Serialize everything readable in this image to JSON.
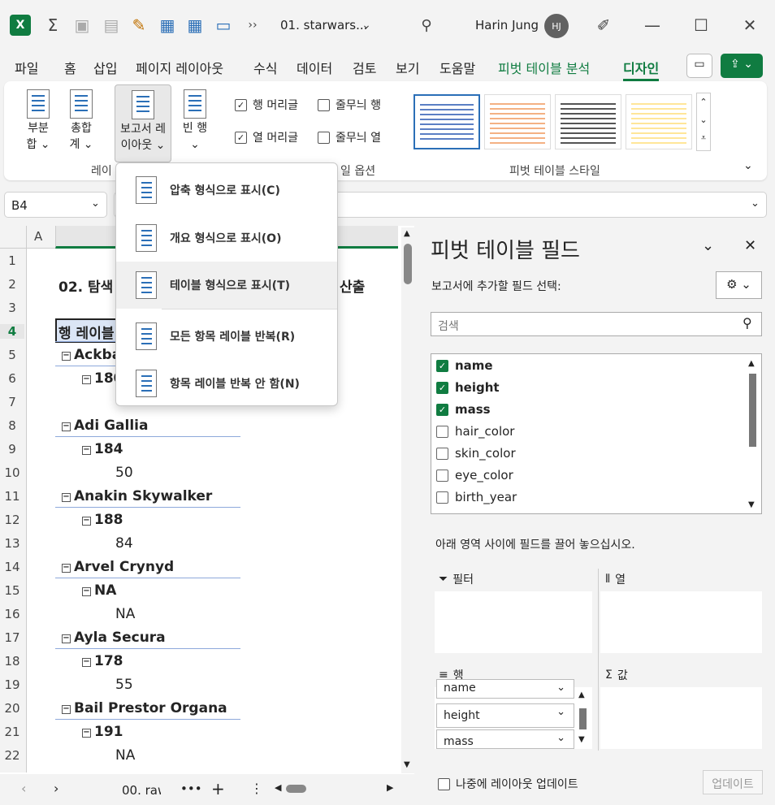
{
  "titlebar": {
    "doc_title": "01. starwars...",
    "user_name": "Harin Jung",
    "avatar_initials": "HJ",
    "overflow": "››"
  },
  "tabs": [
    "파일",
    "홈",
    "삽입",
    "페이지 레이아웃",
    "수식",
    "데이터",
    "검토",
    "보기",
    "도움말",
    "피벗 테이블 분석",
    "디자인"
  ],
  "ribbon": {
    "subtotal": "부분\n합 ⌄",
    "grandtotal": "총합\n계 ⌄",
    "report_layout": "보고서 레\n이아웃 ⌄",
    "blank_rows": "빈 행\n⌄",
    "chk_row_headers": "행 머리글",
    "chk_banded_rows": "줄무늬 행",
    "chk_col_headers": "열 머리글",
    "chk_banded_cols": "줄무늬 열",
    "group_layout": "레이",
    "group_options": "일 옵션",
    "group_styles": "피벗 테이블 스타일"
  },
  "namebox": "B4",
  "dropdown": [
    "압축 형식으로 표시(C)",
    "개요 형식으로 표시(O)",
    "테이블 형식으로 표시(T)",
    "모든 항목 레이블 반복(R)",
    "항목 레이블 반복 안 함(N)"
  ],
  "sheet": {
    "col_a": "A",
    "rows": [
      "1",
      "2",
      "3",
      "4",
      "5",
      "6",
      "7",
      "8",
      "9",
      "10",
      "11",
      "12",
      "13",
      "14",
      "15",
      "16",
      "17",
      "18",
      "19",
      "20",
      "21",
      "22"
    ],
    "title_left": "02. 탐색",
    "title_right": "산출",
    "row_label_header": "행 레이블",
    "c5": "Ackba",
    "c6": "180",
    "c8": "Adi Gallia",
    "c9": "184",
    "c10": "50",
    "c11": "Anakin Skywalker",
    "c12": "188",
    "c13": "84",
    "c14": "Arvel Crynyd",
    "c15": "NA",
    "c16": "NA",
    "c17": "Ayla Secura",
    "c18": "178",
    "c19": "55",
    "c20": "Bail Prestor Organa",
    "c21": "191",
    "c22": "NA",
    "sheet_tab": "00. raw"
  },
  "pane": {
    "title": "피벗 테이블 필드",
    "subtitle": "보고서에 추가할 필드 선택:",
    "search_placeholder": "검색",
    "fields": [
      {
        "name": "name",
        "checked": true
      },
      {
        "name": "height",
        "checked": true
      },
      {
        "name": "mass",
        "checked": true
      },
      {
        "name": "hair_color",
        "checked": false
      },
      {
        "name": "skin_color",
        "checked": false
      },
      {
        "name": "eye_color",
        "checked": false
      },
      {
        "name": "birth_year",
        "checked": false
      }
    ],
    "drag_hint": "아래 영역 사이에 필드를 끌어 놓으십시오.",
    "filter": "필터",
    "columns": "열",
    "rows": "행",
    "values": "값",
    "row_fields": [
      "name",
      "height",
      "mass"
    ],
    "defer": "나중에 레이아웃 업데이트",
    "update": "업데이트"
  }
}
